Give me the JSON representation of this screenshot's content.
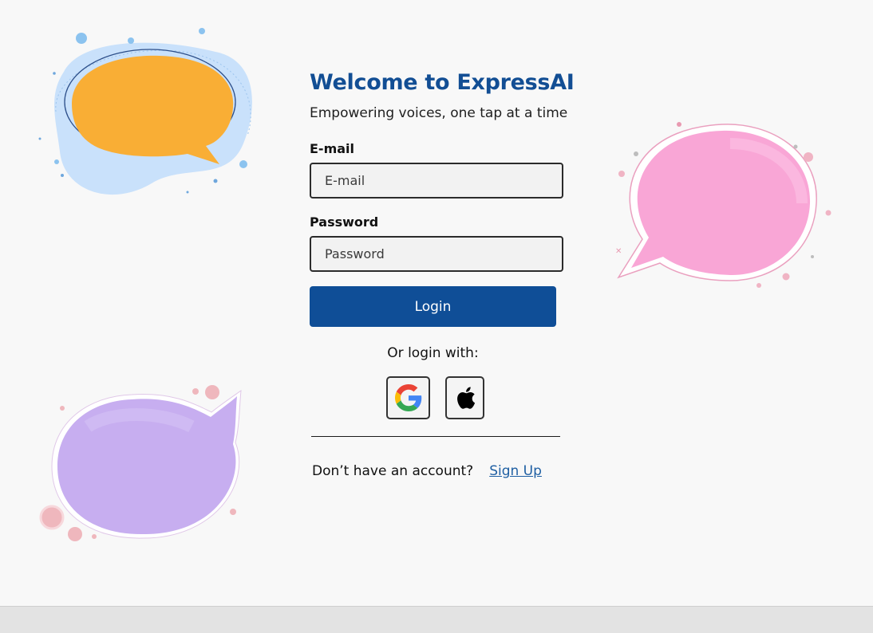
{
  "app": {
    "title": "Welcome to ExpressAI",
    "subtitle": "Empowering voices, one tap at a time"
  },
  "form": {
    "email_label": "E-mail",
    "email_placeholder": "E-mail",
    "email_value": "",
    "password_label": "Password",
    "password_placeholder": "Password",
    "password_value": "",
    "login_label": "Login",
    "or_login_with": "Or login with:",
    "social": [
      {
        "icon": "google-icon"
      },
      {
        "icon": "apple-icon"
      }
    ],
    "no_account_text": "Don’t have an account?",
    "signup_label": "Sign Up"
  },
  "colors": {
    "brand": "#124e94",
    "button": "#0f4e97",
    "link": "#1f5fa3",
    "bubble_orange": "#f9ae35",
    "bubble_blue": "#c9e1fb",
    "bubble_pink": "#f9a6d6",
    "bubble_purple": "#c7aef0"
  },
  "decorations": [
    {
      "name": "orange-speech-bubble-illustration"
    },
    {
      "name": "pink-speech-bubble-illustration"
    },
    {
      "name": "purple-speech-bubble-illustration"
    }
  ]
}
